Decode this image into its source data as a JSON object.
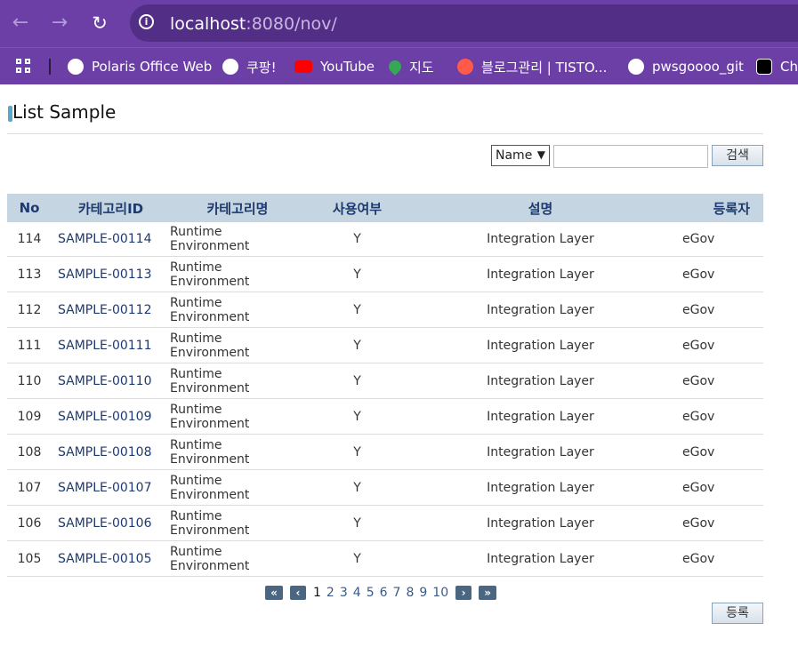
{
  "browser": {
    "url_host": "localhost",
    "url_rest": ":8080/nov/",
    "bookmarks": [
      {
        "label": "Polaris Office Web",
        "icon": "globe-icon",
        "color": "#ffffff"
      },
      {
        "label": "쿠팡!",
        "icon": "globe-icon",
        "color": "#ffffff"
      },
      {
        "label": "YouTube",
        "icon": "youtube-icon",
        "color": "#ff0000"
      },
      {
        "label": "지도",
        "icon": "maps-icon",
        "color": "#34a853"
      },
      {
        "label": "블로그관리 | TISTO...",
        "icon": "tistory-icon",
        "color": "#ff5a4a"
      },
      {
        "label": "pwsgoooo_git",
        "icon": "github-icon",
        "color": "#ffffff"
      },
      {
        "label": "Cha",
        "icon": "chatgpt-icon",
        "color": "#000000"
      }
    ]
  },
  "page": {
    "title": "List Sample",
    "search_select": "Name",
    "search_button": "검색",
    "register_button": "등록"
  },
  "table": {
    "headers": [
      "No",
      "카테고리ID",
      "카테고리명",
      "사용여부",
      "설명",
      "등록자"
    ],
    "rows": [
      [
        "114",
        "SAMPLE-00114",
        "Runtime Environment",
        "Y",
        "Integration Layer",
        "eGov"
      ],
      [
        "113",
        "SAMPLE-00113",
        "Runtime Environment",
        "Y",
        "Integration Layer",
        "eGov"
      ],
      [
        "112",
        "SAMPLE-00112",
        "Runtime Environment",
        "Y",
        "Integration Layer",
        "eGov"
      ],
      [
        "111",
        "SAMPLE-00111",
        "Runtime Environment",
        "Y",
        "Integration Layer",
        "eGov"
      ],
      [
        "110",
        "SAMPLE-00110",
        "Runtime Environment",
        "Y",
        "Integration Layer",
        "eGov"
      ],
      [
        "109",
        "SAMPLE-00109",
        "Runtime Environment",
        "Y",
        "Integration Layer",
        "eGov"
      ],
      [
        "108",
        "SAMPLE-00108",
        "Runtime Environment",
        "Y",
        "Integration Layer",
        "eGov"
      ],
      [
        "107",
        "SAMPLE-00107",
        "Runtime Environment",
        "Y",
        "Integration Layer",
        "eGov"
      ],
      [
        "106",
        "SAMPLE-00106",
        "Runtime Environment",
        "Y",
        "Integration Layer",
        "eGov"
      ],
      [
        "105",
        "SAMPLE-00105",
        "Runtime Environment",
        "Y",
        "Integration Layer",
        "eGov"
      ]
    ]
  },
  "pagination": {
    "first": "«",
    "prev": "‹",
    "pages": [
      "1",
      "2",
      "3",
      "4",
      "5",
      "6",
      "7",
      "8",
      "9",
      "10"
    ],
    "current": "1",
    "next": "›",
    "last": "»"
  }
}
